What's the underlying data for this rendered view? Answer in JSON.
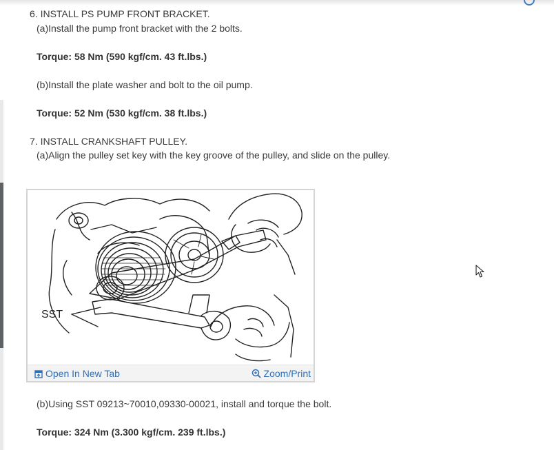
{
  "steps": [
    {
      "title": "6. INSTALL PS PUMP FRONT BRACKET.",
      "subs": [
        {
          "text": "(a)Install the pump front bracket with the 2 bolts.",
          "torque": "Torque: 58 Nm (590 kgf/cm. 43 ft.lbs.)"
        },
        {
          "text": "(b)Install the plate washer and bolt to the oil pump.",
          "torque": "Torque: 52 Nm (530 kgf/cm. 38 ft.lbs.)"
        }
      ]
    },
    {
      "title": "7. INSTALL CRANKSHAFT PULLEY.",
      "subs": [
        {
          "text": "(a)Align the pulley set key with the key groove of the pulley, and slide on the pulley."
        },
        {
          "text": "(b)Using SST 09213~70010,09330-00021, install and torque the bolt.",
          "torque": "Torque: 324 Nm (3.300 kgf/cm. 239 ft.lbs.)"
        }
      ]
    }
  ],
  "figure": {
    "label": "SST",
    "open_link": "Open In New Tab",
    "zoom_link": "Zoom/Print",
    "open_icon": "open-new-tab-icon",
    "zoom_icon": "zoom-in-icon",
    "link_color": "#2f6fb5"
  }
}
